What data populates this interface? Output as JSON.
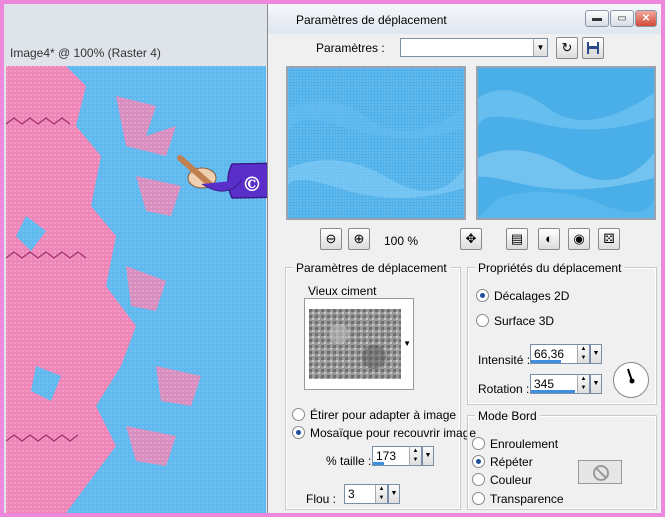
{
  "document": {
    "title": "Image4* @ 100% (Raster 4)"
  },
  "watermark": {
    "text": "© Lila"
  },
  "dialog": {
    "title": "Paramètres de déplacement",
    "window_buttons": {
      "minimize": "▬",
      "maximize": "▭",
      "close": "✕"
    },
    "presets": {
      "label": "Paramètres :",
      "value": ""
    },
    "zoom": {
      "value": "100 %"
    },
    "displacement_params": {
      "title": "Paramètres de déplacement",
      "map_name": "Vieux ciment",
      "stretch_label": "Étirer pour adapter à image",
      "tile_label": "Mosaïque pour recouvrir image",
      "size_label": "% taille :",
      "size_value": "173",
      "size_fraction": 0.3,
      "blur_label": "Flou :",
      "blur_value": "3",
      "selected": "tile"
    },
    "properties": {
      "title": "Propriétés du déplacement",
      "offset2d_label": "Décalages 2D",
      "surface3d_label": "Surface 3D",
      "selected": "offset2d",
      "intensity_label": "Intensité :",
      "intensity_value": "66,36",
      "intensity_fraction": 0.66,
      "rotation_label": "Rotation :",
      "rotation_value": "345",
      "rotation_fraction": 0.96
    },
    "edge_mode": {
      "title": "Mode Bord",
      "options": [
        "Enroulement",
        "Répéter",
        "Couleur",
        "Transparence"
      ],
      "selected": "Répéter"
    }
  },
  "colors": {
    "canvas_blue": "#5fb8ee",
    "canvas_pink": "#ee86b8",
    "watermark_purple": "#5a2fc9",
    "accent_blue": "#3f8fe0"
  }
}
